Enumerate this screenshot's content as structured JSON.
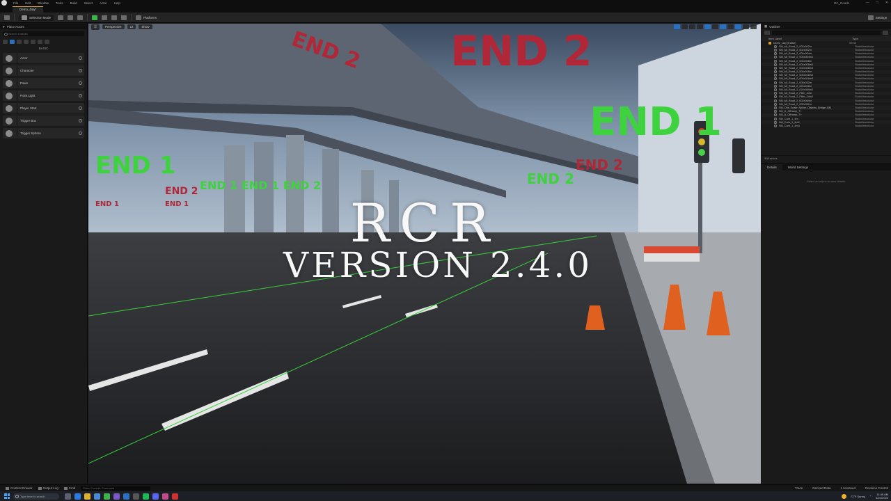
{
  "app": {
    "project_name": "RC_Roads",
    "menus": [
      "File",
      "Edit",
      "Window",
      "Tools",
      "Build",
      "Select",
      "Actor",
      "Help"
    ],
    "level_tab": "Demo_Day*"
  },
  "toolbar": {
    "mode_label": "Selection Mode",
    "platforms_label": "Platforms",
    "settings_label": "Settings"
  },
  "place_actors": {
    "title": "Place Actors",
    "search_placeholder": "Search Classes",
    "section": "BASIC",
    "items": [
      {
        "label": "Actor",
        "icon": "actor-icon"
      },
      {
        "label": "Character",
        "icon": "character-icon"
      },
      {
        "label": "Pawn",
        "icon": "pawn-icon"
      },
      {
        "label": "Point Light",
        "icon": "point-light-icon"
      },
      {
        "label": "Player Start",
        "icon": "player-start-icon"
      },
      {
        "label": "Trigger Box",
        "icon": "trigger-box-icon"
      },
      {
        "label": "Trigger Sphere",
        "icon": "trigger-sphere-icon"
      }
    ]
  },
  "viewport": {
    "buttons": [
      "Perspective",
      "Lit",
      "Show"
    ],
    "title_main": "RCR",
    "title_version": "VERSION 2.4.0"
  },
  "outliner": {
    "title": "Outliner",
    "col_label": "Item Label",
    "col_type": "Type",
    "root": {
      "name": "Demo_Day (Editor)",
      "type": "World"
    },
    "rows": [
      {
        "name": "SM_Mi_Road_2_002x002m",
        "type": "StaticMeshActor"
      },
      {
        "name": "SM_Mi_Road_2_002x002m",
        "type": "StaticMeshActor"
      },
      {
        "name": "SM_Mi_Road_2_004x004m",
        "type": "StaticMeshActor"
      },
      {
        "name": "SM_Mi_Road_2_004x004m2",
        "type": "StaticMeshActor"
      },
      {
        "name": "SM_Mi_Road_2_004x008m",
        "type": "StaticMeshActor"
      },
      {
        "name": "SM_Mi_Road_2_004x008m2",
        "type": "StaticMeshActor"
      },
      {
        "name": "SM_Mi_Road_2_004x008m3",
        "type": "StaticMeshActor"
      },
      {
        "name": "SM_Mi_Road_2_004x016m",
        "type": "StaticMeshActor"
      },
      {
        "name": "SM_Mi_Road_2_004x016m2",
        "type": "StaticMeshActor"
      },
      {
        "name": "SM_Mi_Road_2_004x016m3",
        "type": "StaticMeshActor"
      },
      {
        "name": "SM_Mi_Road_2_005x032m",
        "type": "StaticMeshActor"
      },
      {
        "name": "SM_Mi_Road_2_024x016m",
        "type": "StaticMeshActor"
      },
      {
        "name": "SM_Mi_Road_2_024x064m2",
        "type": "StaticMeshActor"
      },
      {
        "name": "SM_Mi_Road_2_Filler_24m",
        "type": "StaticMeshActor"
      },
      {
        "name": "SM_Mi_Road_2_Filler_24m2",
        "type": "StaticMeshActor"
      },
      {
        "name": "SM_Mi_Road_2_002x064m",
        "type": "StaticMeshActor"
      },
      {
        "name": "SM_Mi_Road_2_002x032m",
        "type": "StaticMeshActor"
      },
      {
        "name": "SM_Obs_Scale_Spline_Objects_Bridge_BM",
        "type": "StaticMeshActor"
      },
      {
        "name": "SM_A_Offramp_T+",
        "type": "StaticMeshActor"
      },
      {
        "name": "SM_A_Offramp_T+",
        "type": "StaticMeshActor"
      },
      {
        "name": "SM_Curb_1_4m",
        "type": "StaticMeshActor"
      },
      {
        "name": "SM_Curb_1_4m2",
        "type": "StaticMeshActor"
      },
      {
        "name": "SM_Curb_1_4m3",
        "type": "StaticMeshActor"
      }
    ],
    "footer": "308 actors"
  },
  "details": {
    "tab_details": "Details",
    "tab_world_settings": "World Settings",
    "empty_text": "Select an object to view details."
  },
  "statusbar": {
    "content_drawer": "Content Drawer",
    "output_log": "Output Log",
    "cmd": "Cmd",
    "cmd_placeholder": "Enter Console Command",
    "trace": "Trace",
    "derived_data": "Derived Data",
    "unsaved": "1 Unsaved",
    "revision_control": "Revision Control"
  },
  "taskbar": {
    "search_placeholder": "Type here to search",
    "weather": "73°F Sunny",
    "time": "11:45 AM",
    "date": "4/24/2023"
  },
  "colors": {
    "accent_blue": "#2a70c0",
    "tab_accent": "#e0a030",
    "play_green": "#3fb34a",
    "end_text_green": "#3ed23e",
    "end_text_red": "#b02838"
  }
}
